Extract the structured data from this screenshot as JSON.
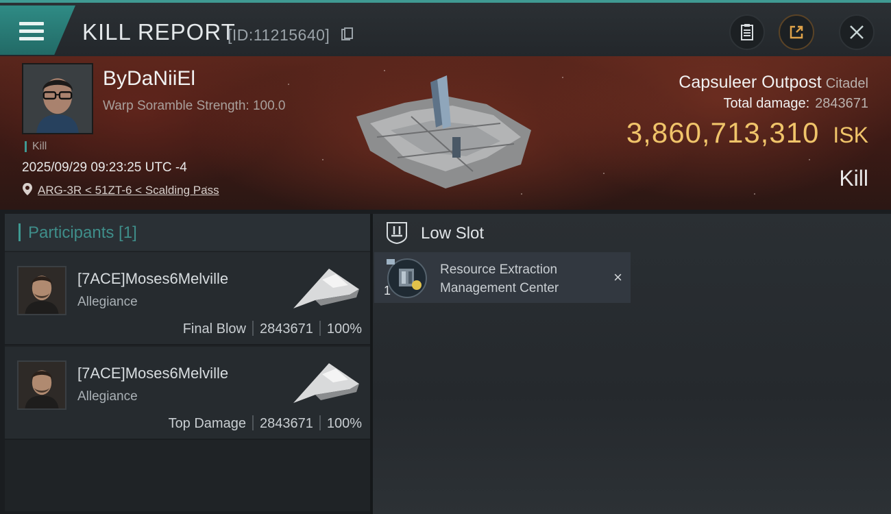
{
  "header": {
    "title": "KILL REPORT",
    "report_id": "[ID:11215640]"
  },
  "victim": {
    "name": "ByDaNiiEl",
    "warp_scramble": "Warp Soramble Strength: 100.0",
    "kill_tag": "Kill",
    "datetime": "2025/09/29 09:23:25 UTC -4",
    "location": "ARG-3R < 51ZT-6 < Scalding Pass",
    "ship_name": "Capsuleer Outpost",
    "ship_class": "Citadel",
    "total_damage_label": "Total damage:",
    "total_damage": "2843671",
    "isk_value": "3,860,713,310",
    "isk_unit": "ISK",
    "result": "Kill"
  },
  "participants": {
    "header": "Participants [1]",
    "rows": [
      {
        "name": "[7ACE]Moses6Melville",
        "corp": "Allegiance",
        "role": "Final Blow",
        "damage": "2843671",
        "percent": "100%"
      },
      {
        "name": "[7ACE]Moses6Melville",
        "corp": "Allegiance",
        "role": "Top Damage",
        "damage": "2843671",
        "percent": "100%"
      }
    ]
  },
  "fitting": {
    "slot_title": "Low Slot",
    "module": {
      "name": "Resource Extraction Management Center",
      "qty": "1",
      "close": "×"
    }
  },
  "colors": {
    "accent": "#3f9a93",
    "isk": "#f0c46a"
  },
  "icons": [
    "menu-icon",
    "copy-icon",
    "clipboard-icon",
    "share-icon",
    "close-icon",
    "location-pin-icon",
    "low-slot-icon",
    "module-icon"
  ]
}
